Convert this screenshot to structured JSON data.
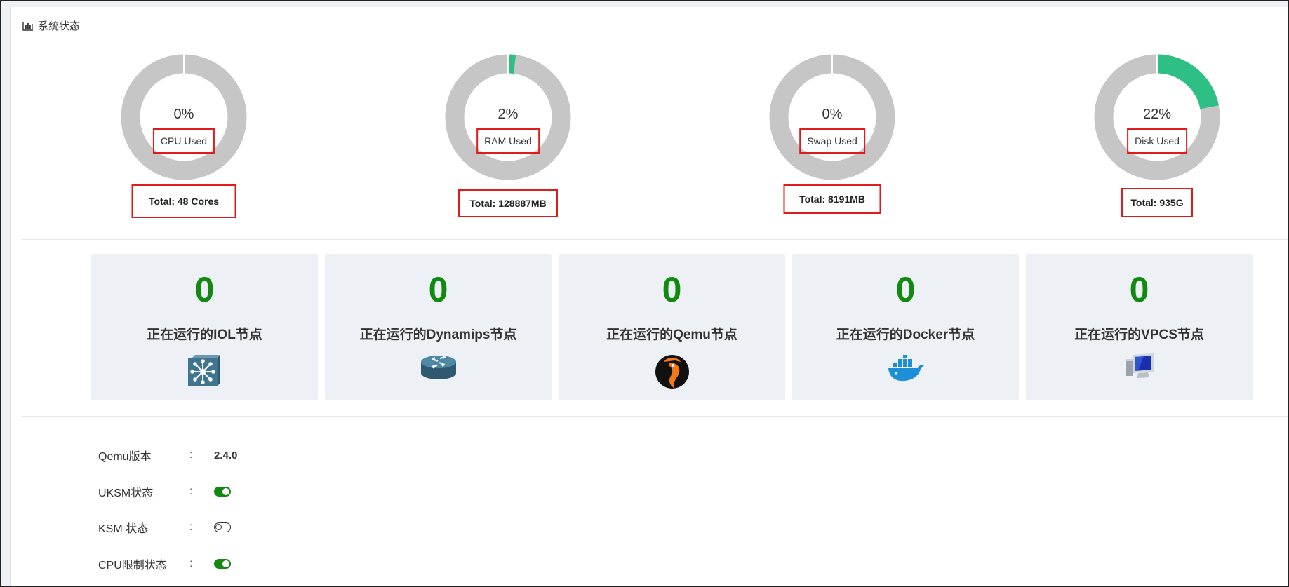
{
  "panel": {
    "title": "系统状态"
  },
  "gauges": [
    {
      "percent_text": "0%",
      "percent": 0,
      "label": "CPU Used",
      "total": "Total: 48 Cores"
    },
    {
      "percent_text": "2%",
      "percent": 2,
      "label": "RAM Used",
      "total": "Total: 128887MB"
    },
    {
      "percent_text": "0%",
      "percent": 0,
      "label": "Swap Used",
      "total": "Total: 8191MB"
    },
    {
      "percent_text": "22%",
      "percent": 22,
      "label": "Disk Used",
      "total": "Total: 935G"
    }
  ],
  "colors": {
    "ring_bg": "#c6c6c6",
    "ring_used": "#2ebf84",
    "count": "#128a12",
    "highlight": "#e01b1b"
  },
  "nodes": [
    {
      "count": "0",
      "label": "正在运行的IOL节点",
      "icon": "switch-icon"
    },
    {
      "count": "0",
      "label": "正在运行的Dynamips节点",
      "icon": "router-icon"
    },
    {
      "count": "0",
      "label": "正在运行的Qemu节点",
      "icon": "qemu-icon"
    },
    {
      "count": "0",
      "label": "正在运行的Docker节点",
      "icon": "docker-icon"
    },
    {
      "count": "0",
      "label": "正在运行的VPCS节点",
      "icon": "pc-icon"
    }
  ],
  "info": [
    {
      "key": "Qemu版本",
      "sep": ":",
      "value": "2.4.0"
    },
    {
      "key": "UKSM状态",
      "sep": ":",
      "toggle": "on"
    },
    {
      "key": "KSM 状态",
      "sep": ":",
      "toggle": "off"
    },
    {
      "key": "CPU限制状态",
      "sep": ":",
      "toggle": "on"
    }
  ]
}
